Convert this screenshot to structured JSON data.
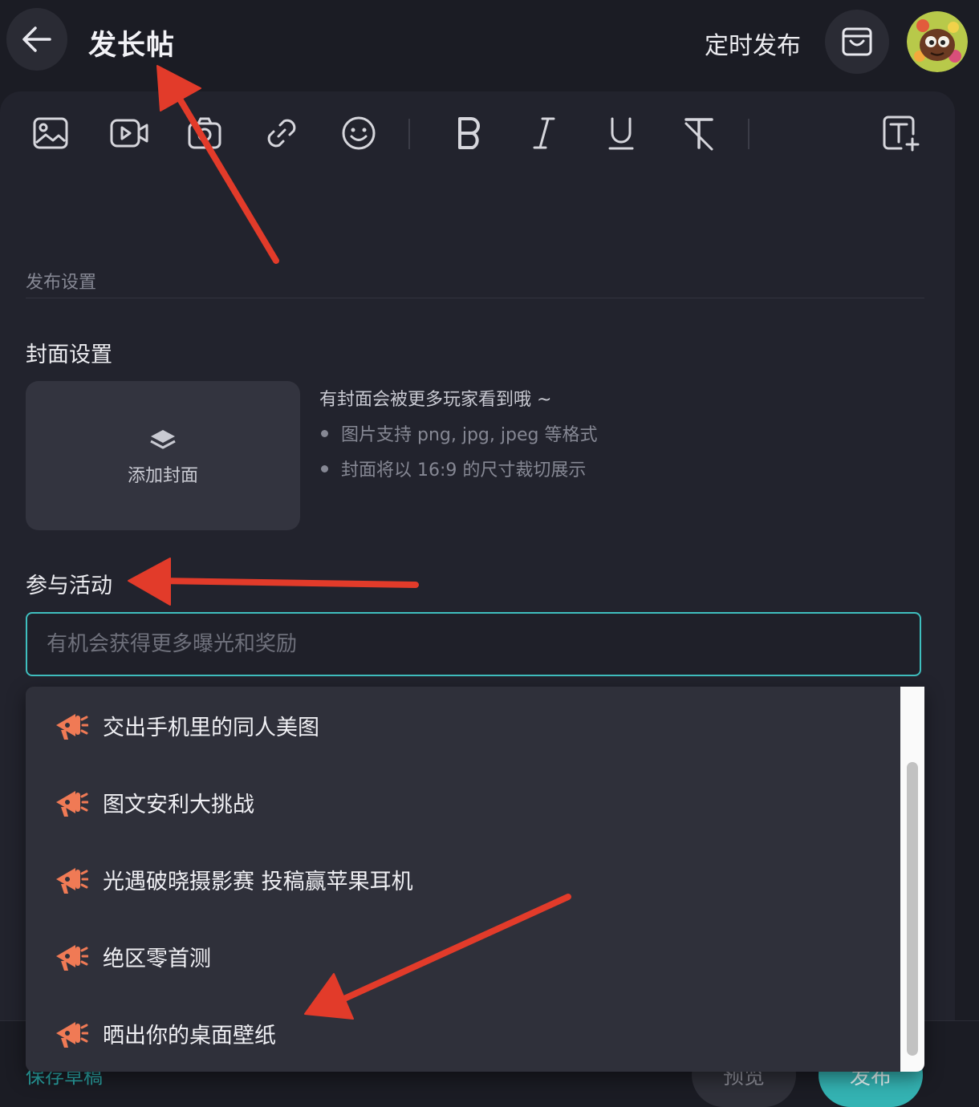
{
  "header": {
    "title": "发长帖",
    "schedule_label": "定时发布"
  },
  "toolbar": {
    "tools": [
      "image-icon",
      "video-icon",
      "camera-icon",
      "link-icon",
      "emoji-icon",
      "bold-icon",
      "italic-icon",
      "underline-icon",
      "clear-format-icon",
      "text-size-icon"
    ]
  },
  "settings": {
    "section_label": "发布设置",
    "cover": {
      "title": "封面设置",
      "button_label": "添加封面",
      "tip_main": "有封面会被更多玩家看到哦 ~",
      "tips": [
        "图片支持 png, jpg, jpeg 等格式",
        "封面将以 16:9 的尺寸裁切展示"
      ]
    },
    "event": {
      "title": "参与活动",
      "placeholder": "有机会获得更多曝光和奖励",
      "value": ""
    }
  },
  "dropdown": {
    "items": [
      {
        "label": "交出手机里的同人美图",
        "icon": "megaphone-icon"
      },
      {
        "label": "图文安利大挑战",
        "icon": "megaphone-icon"
      },
      {
        "label": "光遇破晓摄影赛 投稿赢苹果耳机",
        "icon": "megaphone-icon"
      },
      {
        "label": "绝区零首测",
        "icon": "megaphone-icon"
      },
      {
        "label": "晒出你的桌面壁纸",
        "icon": "megaphone-icon"
      }
    ]
  },
  "footer": {
    "save_draft": "保存草稿",
    "preview": "预览",
    "publish": "发布"
  },
  "colors": {
    "background": "#1b1c24",
    "accent": "#3fbfbf",
    "megaphone": "#f07a55",
    "annotation_arrow": "#e23b2a"
  }
}
